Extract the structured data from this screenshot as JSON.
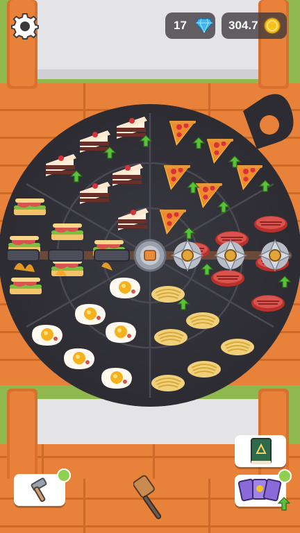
{
  "hud": {
    "gems": "17",
    "coins": "304.7",
    "gem_color": "#3fb6f0",
    "coin_color": "#f6c21c"
  },
  "icons": {
    "settings": "gear-icon",
    "gem": "diamond-icon",
    "coin": "coin-icon",
    "hammer": "hammer-icon",
    "spatula": "spatula-icon",
    "recipe_book": "book-icon",
    "cards": "cards-icon"
  },
  "board": {
    "sections": [
      "cake",
      "pizza",
      "sandwich",
      "steak",
      "fried-egg",
      "spaghetti"
    ],
    "blade_count": 3
  }
}
